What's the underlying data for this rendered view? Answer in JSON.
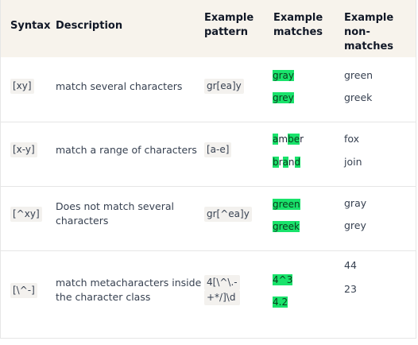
{
  "headers": {
    "syntax": "Syntax",
    "description": "Description",
    "example_pattern_line1": "Example",
    "example_pattern_line2": "pattern",
    "example_matches_line1": "Example",
    "example_matches_line2": "matches",
    "example_nonmatches_line1": "Example non-",
    "example_nonmatches_line2": "matches"
  },
  "rows": [
    {
      "syntax": "[xy]",
      "description": "match several characters",
      "pattern": "gr[ea]y",
      "matches": [
        [
          "gray",
          ""
        ],
        [
          "grey",
          ""
        ]
      ],
      "nonmatches": [
        "green",
        "greek"
      ]
    },
    {
      "syntax": "[x-y]",
      "description": "match a range of characters",
      "pattern": "[a-e]",
      "nonmatches": [
        "fox",
        "join"
      ]
    },
    {
      "syntax": "[^xy]",
      "description_line1": "Does not match several",
      "description_line2": "characters",
      "pattern": "gr[^ea]y",
      "matches": [
        "green",
        "greek"
      ],
      "nonmatches": [
        "gray",
        "grey"
      ]
    },
    {
      "syntax": "[\\^-]",
      "description_line1": "match metacharacters inside",
      "description_line2": "the character class",
      "pattern_line1": "4[\\^\\.-",
      "pattern_line2": "+*/]\\d",
      "matches": [
        "4^3",
        "4.2"
      ],
      "nonmatches": [
        "44",
        "23"
      ]
    }
  ],
  "amber_parts": [
    "a",
    "m",
    "b",
    "e",
    "r"
  ],
  "brand_parts": [
    "b",
    "r",
    "a",
    "n",
    "d"
  ],
  "colors": {
    "highlight": "#19e36b",
    "header_bg": "#f7f3ec",
    "code_bg": "#f3f1ee"
  }
}
